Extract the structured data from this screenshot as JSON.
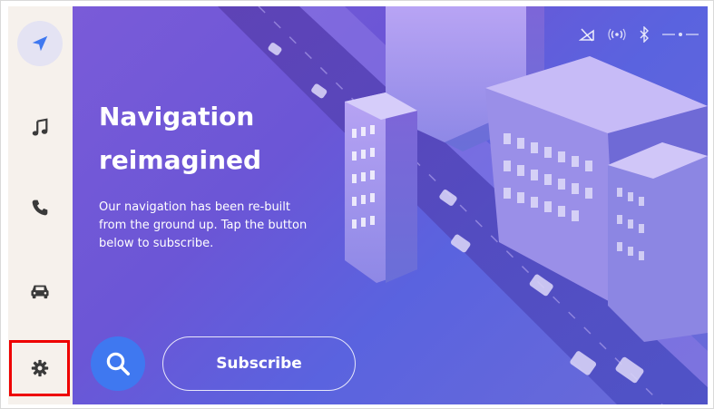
{
  "sidebar": {
    "items": [
      {
        "name": "navigation",
        "icon": "navigation-arrow-icon",
        "active": true
      },
      {
        "name": "music",
        "icon": "music-note-icon",
        "active": false
      },
      {
        "name": "phone",
        "icon": "phone-icon",
        "active": false
      },
      {
        "name": "car",
        "icon": "car-icon",
        "active": false
      },
      {
        "name": "settings",
        "icon": "gear-icon",
        "active": false,
        "highlighted": true
      }
    ]
  },
  "status_bar": {
    "icons": [
      "no-signal-icon",
      "wireless-signal-icon",
      "bluetooth-icon",
      "settings-dots-icon"
    ]
  },
  "hero": {
    "title_line1": "Navigation",
    "title_line2": "reimagined",
    "body_line1": "Our navigation has been re-built",
    "body_line2": "from the ground up. Tap the button",
    "body_line3": "below to subscribe."
  },
  "actions": {
    "subscribe_label": "Subscribe"
  },
  "colors": {
    "accent": "#3f78f0",
    "sidebar_bg": "#f6f1ec",
    "active_pill": "#e4e3f3",
    "highlight_border": "#e00000",
    "icon_color": "#3a3a3a",
    "nav_icon_color": "#3f78f0"
  }
}
